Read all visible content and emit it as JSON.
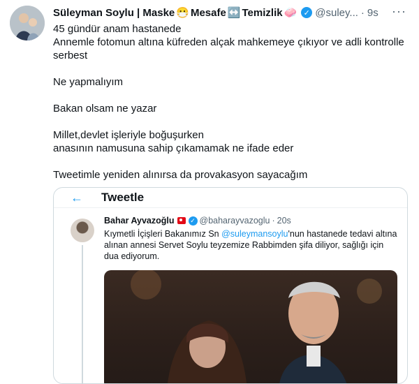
{
  "tweet": {
    "author_name": "Süleyman Soylu | Maske",
    "name_word_2": "Mesafe",
    "name_word_3": "Temizlik",
    "handle": "@suley...",
    "dot": "·",
    "time": "9s",
    "more": "···",
    "lines": [
      "45 gündür anam hastanede",
      "Annemle fotomun altına küfreden alçak mahkemeye çıkıyor ve adli kontrolle serbest",
      "",
      "Ne yapmalıyım",
      "",
      "Bakan olsam ne yazar",
      "",
      "Millet,devlet işleriyle boğuşurken",
      "anasının namusuna sahip çıkamamak ne ifade eder",
      "",
      "Tweetimle yeniden alınırsa da provakasyon sayacağım"
    ]
  },
  "quoted": {
    "back_arrow": "←",
    "title": "Tweetle",
    "author_name": "Bahar Ayvazoğlu",
    "handle": "@baharayvazoglu",
    "dot": "·",
    "time": "20s",
    "text_before": "Kıymetli İçişleri Bakanımız Sn ",
    "mention": "@suleymansoylu",
    "text_after": "'nun hastanede tedavi altına alınan annesi Servet Soylu teyzemize Rabbimden şifa diliyor, sağlığı için dua ediyorum."
  },
  "icons": {
    "verified": "verified-badge-icon",
    "emoji_mask": "😷",
    "emoji_arrows": "↔️",
    "emoji_soap": "🧼"
  },
  "colors": {
    "accent": "#1d9bf0",
    "muted": "#536471",
    "border": "#cfd9de"
  }
}
